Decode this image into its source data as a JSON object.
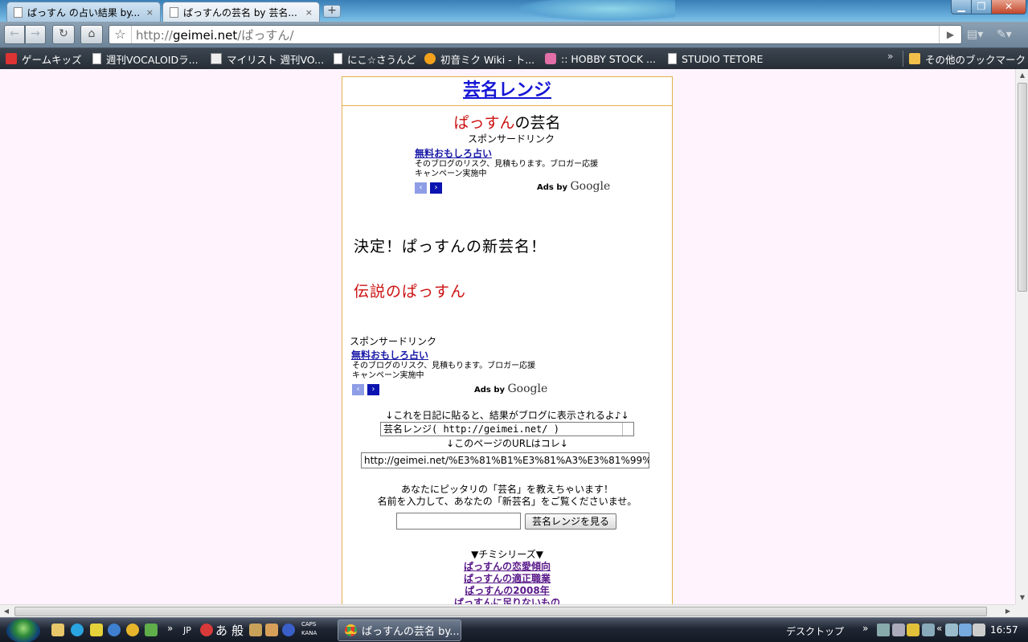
{
  "browser": {
    "tabs": [
      {
        "label": "ぱっすん の占い結果 by...",
        "active": false
      },
      {
        "label": "ぱっすんの芸名 by 芸名...",
        "active": true
      }
    ],
    "close_glyph": "×",
    "new_tab_glyph": "+",
    "window_buttons": {
      "minimize": "▁",
      "maximize": "❐",
      "close": "✕"
    },
    "url": {
      "scheme": "http://",
      "host": "geimei.net",
      "path": "/ぱっすん/"
    },
    "bookmarks": [
      {
        "label": "ゲームキッズ",
        "icon": "red"
      },
      {
        "label": "週刊VOCALOIDラ...",
        "icon": "page"
      },
      {
        "label": "マイリスト 週刊VO...",
        "icon": "img"
      },
      {
        "label": "にこ☆さうんど",
        "icon": "page"
      },
      {
        "label": "初音ミク Wiki - ト...",
        "icon": "orange"
      },
      {
        "label": ":: HOBBY STOCK ...",
        "icon": "pink"
      },
      {
        "label": "STUDIO TETORE",
        "icon": "page"
      }
    ],
    "other_bookmarks": "その他のブックマーク",
    "chevron": "»"
  },
  "page": {
    "site_title": "芸名レンジ",
    "name": "ぱっすん",
    "name_suffix": "の芸名",
    "ads": {
      "sponsored": "スポンサードリンク",
      "link": "無料おもしろ占い",
      "desc_line1": "そのブログのリスク、見積もります。ブロガー応援",
      "desc_line2": "キャンペーン実施中",
      "prev": "‹",
      "next": "›",
      "ads_by": "Ads by",
      "google": "Google"
    },
    "decided": "決定！ぱっすんの新芸名！",
    "result": "伝説のぱっすん",
    "blog_caption": "↓これを日記に貼ると、結果がブログに表示されるよ♪↓",
    "blog_code": "芸名レンジ( http://geimei.net/ )",
    "url_caption": "↓このページのURLはコレ↓",
    "page_url": "http://geimei.net/%E3%81%B1%E3%81%A3%E3%81%99%",
    "intro_line1": "あなたにピッタリの「芸名」を教えちゃいます！",
    "intro_line2": "名前を入力して、あなたの「新芸名」をご覧くださいませ。",
    "name_input_value": "",
    "submit": "芸名レンジを見る",
    "series_title": "▼チミシリーズ▼",
    "series_links": [
      "ぱっすんの恋愛傾向",
      "ぱっすんの適正職業",
      "ぱっすんの2008年",
      "ぱっすんに足りないもの"
    ]
  },
  "taskbar": {
    "language": "JP",
    "ime_mode": "あ",
    "ime_kanji": "般",
    "caps": "CAPS",
    "kana": "KANA",
    "active_window": "ぱっすんの芸名 by...",
    "desktop": "デスクトップ",
    "clock": "16:57"
  },
  "colors": {
    "accent_red": "#cc1111",
    "title_blue": "#1515d6",
    "page_bg": "#fff3fd",
    "border_gold": "#e3b04a"
  }
}
